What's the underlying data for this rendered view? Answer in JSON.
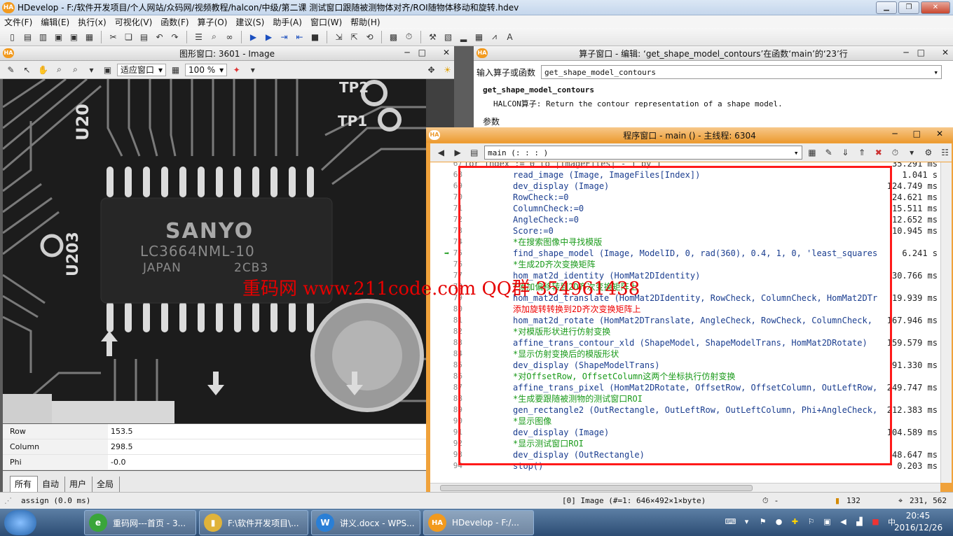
{
  "app": {
    "title": "HDevelop - F:/软件开发项目/个人网站/众码网/视频教程/halcon/中级/第二课 测试窗口跟随被测物体对齐/ROI随物体移动和旋转.hdev",
    "logo": "HA"
  },
  "menu": [
    "文件(F)",
    "编辑(E)",
    "执行(x)",
    "可视化(V)",
    "函数(F)",
    "算子(O)",
    "建议(S)",
    "助手(A)",
    "窗口(W)",
    "帮助(H)"
  ],
  "graphics": {
    "title": "图形窗口: 3601 - Image",
    "fit_label": "适应窗口",
    "zoom": "100 %",
    "chip": {
      "brand": "SANYO",
      "part": "LC3664NML-10",
      "origin": "JAPAN",
      "code": "2CB3",
      "u_top": "U20",
      "u_side": "U203",
      "tp1": "TP1",
      "tp2": "TP2"
    },
    "vars": [
      {
        "name": "Row",
        "value": "153.5"
      },
      {
        "name": "Column",
        "value": "298.5"
      },
      {
        "name": "Phi",
        "value": "-0.0"
      }
    ],
    "tabs": [
      "所有",
      "自动",
      "用户",
      "全局"
    ]
  },
  "operator": {
    "title": "算子窗口 - 编辑: ‘get_shape_model_contours’在函数‘main’的‘23’行",
    "input_label": "输入算子或函数",
    "input_value": "get_shape_model_contours",
    "op_name": "get_shape_model_contours",
    "op_desc": "HALCON算子: Return the contour representation of a shape model.",
    "params_label": "参数"
  },
  "program": {
    "title": "程序窗口 - main () - 主线程: 6304",
    "procedure": "main (: : : )",
    "lines": [
      {
        "n": "67",
        "t": "for Index := 0 to |ImageFiles| - 1 by 1",
        "k": "kw",
        "i": 0,
        "time": "35.291 ms"
      },
      {
        "n": "68",
        "t": "read_image (Image, ImageFiles[Index])",
        "k": "op",
        "i": 1,
        "time": "1.041  s"
      },
      {
        "n": "69",
        "t": "dev_display (Image)",
        "k": "op",
        "i": 1,
        "time": "124.749 ms"
      },
      {
        "n": "70",
        "t": "RowCheck:=0",
        "k": "op",
        "i": 1,
        "time": "24.621 ms"
      },
      {
        "n": "71",
        "t": "ColumnCheck:=0",
        "k": "op",
        "i": 1,
        "time": "15.511 ms"
      },
      {
        "n": "72",
        "t": "AngleCheck:=0",
        "k": "op",
        "i": 1,
        "time": "12.652 ms"
      },
      {
        "n": "73",
        "t": "Score:=0",
        "k": "op",
        "i": 1,
        "time": "10.945 ms"
      },
      {
        "n": "74",
        "t": "*在搜索图像中寻找模版",
        "k": "cm",
        "i": 1,
        "time": ""
      },
      {
        "n": "75",
        "t": "find_shape_model (Image, ModelID, 0, rad(360), 0.4, 1, 0, 'least_squares',",
        "k": "op",
        "i": 1,
        "time": "6.241  s"
      },
      {
        "n": "76",
        "t": "*生成2D齐次变换矩阵",
        "k": "cm",
        "i": 1,
        "time": ""
      },
      {
        "n": "77",
        "t": "hom_mat2d_identity (HomMat2DIdentity)",
        "k": "op",
        "i": 1,
        "time": "30.766 ms"
      },
      {
        "n": "78",
        "t": "*添加偏移转到2D齐次变换矩阵上",
        "k": "cm",
        "i": 1,
        "time": ""
      },
      {
        "n": "79",
        "t": "hom_mat2d_translate (HomMat2DIdentity, RowCheck, ColumnCheck, HomMat2DTrans",
        "k": "op",
        "i": 1,
        "time": "19.939 ms"
      },
      {
        "n": "80",
        "t": "添加旋转转换到2D齐次变换矩阵上",
        "k": "red",
        "i": 1,
        "time": ""
      },
      {
        "n": "81",
        "t": "hom_mat2d_rotate (HomMat2DTranslate, AngleCheck, RowCheck, ColumnCheck, Hom",
        "k": "op",
        "i": 1,
        "time": "167.946 ms"
      },
      {
        "n": "82",
        "t": "*对模版形状进行仿射变换",
        "k": "cm",
        "i": 1,
        "time": ""
      },
      {
        "n": "83",
        "t": "affine_trans_contour_xld (ShapeModel, ShapeModelTrans, HomMat2DRotate)",
        "k": "op",
        "i": 1,
        "time": "159.579 ms"
      },
      {
        "n": "84",
        "t": "*显示仿射变换后的模版形状",
        "k": "cm",
        "i": 1,
        "time": ""
      },
      {
        "n": "85",
        "t": "dev_display (ShapeModelTrans)",
        "k": "op",
        "i": 1,
        "time": "91.330 ms"
      },
      {
        "n": "86",
        "t": "*对OffsetRow, OffsetColumn这两个坐标执行仿射变换",
        "k": "cm",
        "i": 1,
        "time": ""
      },
      {
        "n": "87",
        "t": "affine_trans_pixel (HomMat2DRotate, OffsetRow, OffsetColumn, OutLeftRow, Ou",
        "k": "op",
        "i": 1,
        "time": "249.747 ms"
      },
      {
        "n": "88",
        "t": "*生成要跟随被测物的测试窗口ROI",
        "k": "cm",
        "i": 1,
        "time": ""
      },
      {
        "n": "89",
        "t": "gen_rectangle2 (OutRectangle, OutLeftRow, OutLeftColumn, Phi+AngleCheck, Le",
        "k": "op",
        "i": 1,
        "time": "212.383 ms"
      },
      {
        "n": "90",
        "t": "*显示图像",
        "k": "cm",
        "i": 1,
        "time": ""
      },
      {
        "n": "91",
        "t": "dev_display (Image)",
        "k": "op",
        "i": 1,
        "time": "104.589 ms"
      },
      {
        "n": "92",
        "t": "*显示测试窗口ROI",
        "k": "cm",
        "i": 1,
        "time": ""
      },
      {
        "n": "93",
        "t": "dev_display (OutRectangle)",
        "k": "op",
        "i": 1,
        "time": "48.647 ms"
      },
      {
        "n": "94",
        "t": "stop()",
        "k": "op",
        "i": 1,
        "time": "0.203 ms"
      }
    ]
  },
  "watermark": "重码网 www.211code.com  QQ群 354961438",
  "status": {
    "left": "assign (0.0 ms)",
    "image_info": "[0] Image (#=1: 646×492×1×byte)",
    "timer": "-",
    "gray_value": "132",
    "coords": "231, 562"
  },
  "taskbar": {
    "items": [
      {
        "label": "重码网---首页 - 3...",
        "color": "#3aa53a",
        "icon": "e"
      },
      {
        "label": "F:\\软件开发项目\\...",
        "color": "#e0b33a",
        "icon": "▮"
      },
      {
        "label": "讲义.docx - WPS...",
        "color": "#2a7fd6",
        "icon": "W"
      },
      {
        "label": "HDevelop - F:/...",
        "color": "#f29a1e",
        "icon": "HA"
      }
    ],
    "time": "20:45",
    "date": "2016/12/26"
  }
}
